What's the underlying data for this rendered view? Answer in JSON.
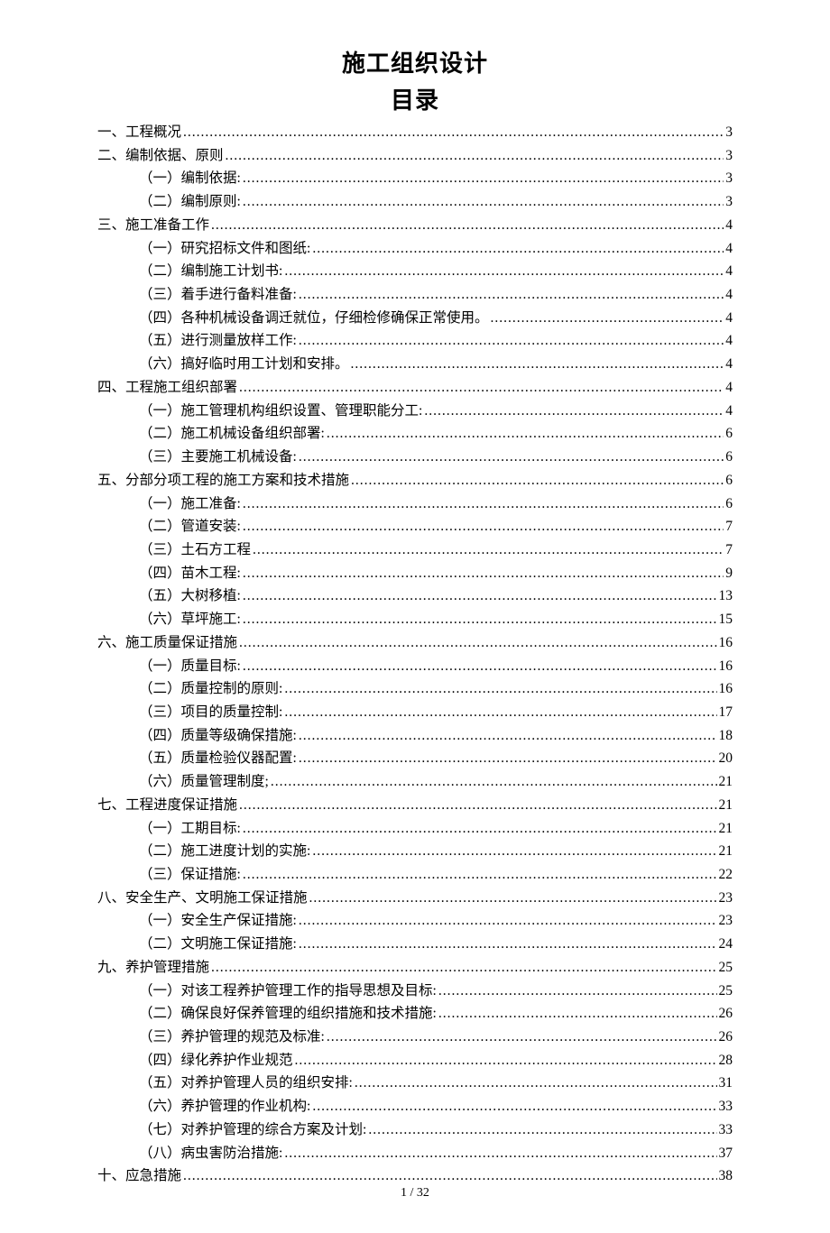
{
  "title": "施工组织设计",
  "subtitle": "目录",
  "footer": "1 / 32",
  "toc": [
    {
      "level": 1,
      "label": "一、工程概况 ",
      "page": "3"
    },
    {
      "level": 1,
      "label": "二、编制依据、原则 ",
      "page": "3"
    },
    {
      "level": 2,
      "label": "（一）编制依据:",
      "page": "3"
    },
    {
      "level": 2,
      "label": "（二）编制原则:",
      "page": "3"
    },
    {
      "level": 1,
      "label": "三、施工准备工作 ",
      "page": "4"
    },
    {
      "level": 2,
      "label": "（一）研究招标文件和图纸:",
      "page": "4"
    },
    {
      "level": 2,
      "label": "（二）编制施工计划书:",
      "page": "4"
    },
    {
      "level": 2,
      "label": "（三）着手进行备料准备:",
      "page": "4"
    },
    {
      "level": 2,
      "label": "（四）各种机械设备调迁就位，仔细检修确保正常使用。",
      "page": "4"
    },
    {
      "level": 2,
      "label": "（五）进行测量放样工作:",
      "page": "4"
    },
    {
      "level": 2,
      "label": "（六）搞好临时用工计划和安排。",
      "page": "4"
    },
    {
      "level": 1,
      "label": "四、工程施工组织部署 ",
      "page": "4"
    },
    {
      "level": 2,
      "label": "（一）施工管理机构组织设置、管理职能分工:",
      "page": "4"
    },
    {
      "level": 2,
      "label": "（二）施工机械设备组织部署:",
      "page": "6"
    },
    {
      "level": 2,
      "label": "（三）主要施工机械设备:",
      "page": "6"
    },
    {
      "level": 1,
      "label": "五、分部分项工程的施工方案和技术措施 ",
      "page": "6"
    },
    {
      "level": 2,
      "label": "（一）施工准备:",
      "page": "6"
    },
    {
      "level": 2,
      "label": "（二）管道安装:",
      "page": "7"
    },
    {
      "level": 2,
      "label": "（三）土石方工程",
      "page": "7"
    },
    {
      "level": 2,
      "label": "（四）苗木工程:",
      "page": "9"
    },
    {
      "level": 2,
      "label": "（五）大树移植:",
      "page": "13"
    },
    {
      "level": 2,
      "label": "（六）草坪施工:",
      "page": "15"
    },
    {
      "level": 1,
      "label": "六、施工质量保证措施 ",
      "page": "16"
    },
    {
      "level": 2,
      "label": "（一）质量目标:",
      "page": "16"
    },
    {
      "level": 2,
      "label": "（二）质量控制的原则:",
      "page": "16"
    },
    {
      "level": 2,
      "label": "（三）项目的质量控制:",
      "page": "17"
    },
    {
      "level": 2,
      "label": "（四）质量等级确保措施:",
      "page": "18"
    },
    {
      "level": 2,
      "label": "（五）质量检验仪器配置:",
      "page": "20"
    },
    {
      "level": 2,
      "label": "（六）质量管理制度;",
      "page": "21"
    },
    {
      "level": 1,
      "label": "七、工程进度保证措施 ",
      "page": "21"
    },
    {
      "level": 2,
      "label": "（一）工期目标:",
      "page": "21"
    },
    {
      "level": 2,
      "label": "（二）施工进度计划的实施:",
      "page": "21"
    },
    {
      "level": 2,
      "label": "（三）保证措施:",
      "page": "22"
    },
    {
      "level": 1,
      "label": "八、安全生产、文明施工保证措施 ",
      "page": "23"
    },
    {
      "level": 2,
      "label": "（一）安全生产保证措施:",
      "page": "23"
    },
    {
      "level": 2,
      "label": "（二）文明施工保证措施:",
      "page": "24"
    },
    {
      "level": 1,
      "label": "九、养护管理措施 ",
      "page": "25"
    },
    {
      "level": 2,
      "label": "（一）对该工程养护管理工作的指导思想及目标:",
      "page": "25"
    },
    {
      "level": 2,
      "label": "（二）确保良好保养管理的组织措施和技术措施:",
      "page": "26"
    },
    {
      "level": 2,
      "label": "（三）养护管理的规范及标准:",
      "page": "26"
    },
    {
      "level": 2,
      "label": "（四）绿化养护作业规范",
      "page": "28"
    },
    {
      "level": 2,
      "label": "（五）对养护管理人员的组织安排:",
      "page": "31"
    },
    {
      "level": 2,
      "label": "（六）养护管理的作业机构:",
      "page": "33"
    },
    {
      "level": 2,
      "label": "（七）对养护管理的综合方案及计划:",
      "page": "33"
    },
    {
      "level": 2,
      "label": "（八）病虫害防治措施:",
      "page": "37"
    },
    {
      "level": 1,
      "label": "十、应急措施 ",
      "page": "38"
    }
  ]
}
